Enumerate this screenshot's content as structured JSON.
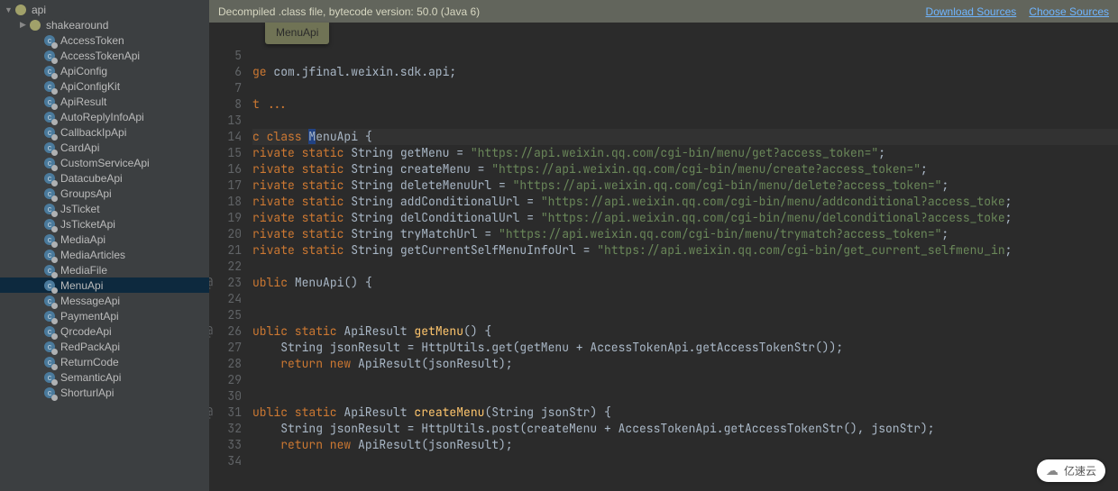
{
  "banner": {
    "text": "Decompiled .class file, bytecode version: 50.0 (Java 6)",
    "download_sources": "Download Sources",
    "choose_sources": "Choose Sources"
  },
  "tab": {
    "label": "MenuApi"
  },
  "tree": {
    "root": "api",
    "folder": "shakearound",
    "items": [
      "AccessToken",
      "AccessTokenApi",
      "ApiConfig",
      "ApiConfigKit",
      "ApiResult",
      "AutoReplyInfoApi",
      "CallbackIpApi",
      "CardApi",
      "CustomServiceApi",
      "DatacubeApi",
      "GroupsApi",
      "JsTicket",
      "JsTicketApi",
      "MediaApi",
      "MediaArticles",
      "MediaFile",
      "MenuApi",
      "MessageApi",
      "PaymentApi",
      "QrcodeApi",
      "RedPackApi",
      "ReturnCode",
      "SemanticApi",
      "ShorturlApi"
    ],
    "selected": "MenuApi"
  },
  "code": {
    "pkg_kw": "ge ",
    "pkg": "com.jfinal.weixin.sdk.api",
    "import_fold": "t ...",
    "class_kw": "c class ",
    "class_name": "MenuApi",
    "brace_open": " {",
    "field_prefix": "rivate static ",
    "string_type": "String ",
    "f1": {
      "name": "getMenu",
      "val": "\"https://api.weixin.qq.com/cgi-bin/menu/get?access_token=\""
    },
    "f2": {
      "name": "createMenu",
      "val": "\"https://api.weixin.qq.com/cgi-bin/menu/create?access_token=\""
    },
    "f3": {
      "name": "deleteMenuUrl",
      "val": "\"https://api.weixin.qq.com/cgi-bin/menu/delete?access_token=\""
    },
    "f4": {
      "name": "addConditionalUrl",
      "val": "\"https://api.weixin.qq.com/cgi-bin/menu/addconditional?access_toke"
    },
    "f5": {
      "name": "delConditionalUrl",
      "val": "\"https://api.weixin.qq.com/cgi-bin/menu/delconditional?access_toke"
    },
    "f6": {
      "name": "tryMatchUrl",
      "val": "\"https://api.weixin.qq.com/cgi-bin/menu/trymatch?access_token=\""
    },
    "f7": {
      "name": "getCurrentSelfMenuInfoUrl",
      "val": "\"https://api.weixin.qq.com/cgi-bin/get_current_selfmenu_in"
    },
    "ctor": "ublic MenuApi() {",
    "m1": {
      "sig": "ublic static ApiResult getMenu() {",
      "b1": "    String jsonResult = HttpUtils.get(getMenu + AccessTokenApi.getAccessTokenStr());",
      "b2_kw": "    return new ",
      "b2_call": "ApiResult(jsonResult);"
    },
    "m2": {
      "sig": "ublic static ApiResult createMenu(String jsonStr) {",
      "b1": "    String jsonResult = HttpUtils.post(createMenu + AccessTokenApi.getAccessTokenStr(), jsonStr);",
      "b2_kw": "    return new ",
      "b2_call": "ApiResult(jsonResult);"
    }
  },
  "line_numbers": [
    5,
    6,
    7,
    8,
    13,
    14,
    15,
    16,
    17,
    18,
    19,
    20,
    21,
    22,
    23,
    24,
    25,
    26,
    27,
    28,
    29,
    30,
    31,
    32,
    33,
    34
  ],
  "watermark": "亿速云"
}
